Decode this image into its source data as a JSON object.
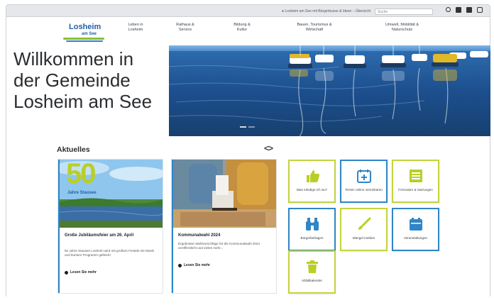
{
  "topbar": {
    "notice": "● Losheim am See mit Bürgerbusse & Ideen – Übersicht",
    "search_placeholder": "Suche"
  },
  "logo": {
    "name": "Losheim",
    "sub": "am See"
  },
  "nav": [
    {
      "line1": "Leben in",
      "line2": "Losheim"
    },
    {
      "line1": "Rathaus &",
      "line2": "Service"
    },
    {
      "line1": "Bildung &",
      "line2": "Kultur"
    },
    {
      "line1": "Bauen, Tourismus &",
      "line2": "Wirtschaft"
    },
    {
      "line1": "Umwelt, Mobilität &",
      "line2": "Naturschutz"
    }
  ],
  "hero": {
    "title_line1": "Willkommen in",
    "title_line2": "der Gemeinde",
    "title_line3": "Losheim am See"
  },
  "news": {
    "section_title": "Aktuelles",
    "arrows": "<>",
    "cards": [
      {
        "badge_number": "50",
        "badge_text": "Jahre Stausee",
        "title": "Große Jubiläumsfeier am 26. April",
        "text": "50 Jahre Stausee Losheim wird mit großem Festakt mit Musik und buntem Programm gefeiert!",
        "more": "Lesen Sie mehr"
      },
      {
        "title": "Kommunalwahl 2024",
        "text": "Ergebnisse Wahlvorschläge für die Kommunalwahl 2024 veröffentlicht und vieles mehr...",
        "more": "Lesen Sie mehr"
      }
    ]
  },
  "tiles": [
    {
      "label": "Was erledige ich wo?",
      "icon": "thumbs-up-icon",
      "accent": "#c4d43d"
    },
    {
      "label": "Termin online vereinbaren",
      "icon": "calendar-plus-icon",
      "accent": "#2f86c6"
    },
    {
      "label": "Formulare & Satzungen",
      "icon": "list-form-icon",
      "accent": "#c4d43d"
    },
    {
      "label": "Bürgerbefragen",
      "icon": "binoculars-icon",
      "accent": "#2f86c6"
    },
    {
      "label": "Mängel melden",
      "icon": "brush-icon",
      "accent": "#c4d43d"
    },
    {
      "label": "Veranstaltungen",
      "icon": "calendar-icon",
      "accent": "#2f86c6"
    },
    {
      "label": "Abfallkalender",
      "icon": "trash-icon",
      "accent": "#c4d43d"
    }
  ],
  "colors": {
    "green": "#8dbf2d",
    "blue": "#2f86c6",
    "lime": "#c4d43d"
  }
}
